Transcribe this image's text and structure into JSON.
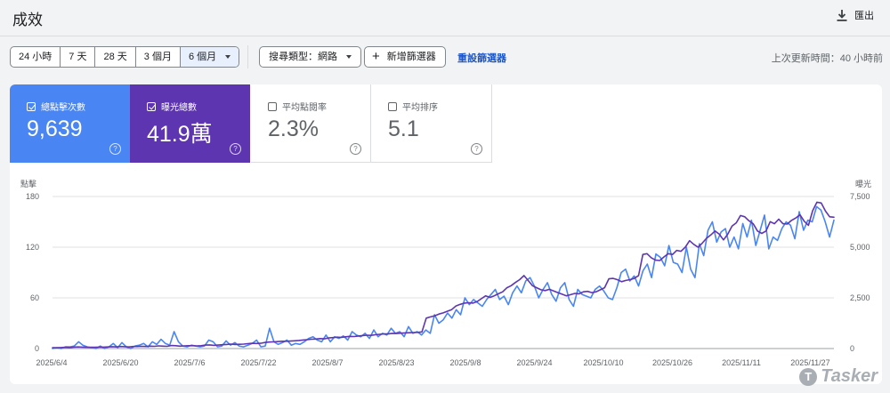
{
  "header": {
    "title": "成效",
    "export_label": "匯出"
  },
  "filters": {
    "date_ranges": [
      {
        "label": "24 小時",
        "selected": false
      },
      {
        "label": "7 天",
        "selected": false
      },
      {
        "label": "28 天",
        "selected": false
      },
      {
        "label": "3 個月",
        "selected": false
      },
      {
        "label": "6 個月",
        "selected": true
      }
    ],
    "search_type": "搜尋類型：網路",
    "add_filter": "新增篩選器",
    "reset": "重設篩選器",
    "last_updated": "上次更新時間：40 小時前"
  },
  "metrics": [
    {
      "label": "總點擊次數",
      "value": "9,639",
      "checked": true,
      "color": "#4a86f3"
    },
    {
      "label": "曝光總數",
      "value": "41.9萬",
      "checked": true,
      "color": "#5e35b1"
    },
    {
      "label": "平均點閱率",
      "value": "2.3%",
      "checked": false
    },
    {
      "label": "平均排序",
      "value": "5.1",
      "checked": false
    }
  ],
  "watermark": "Tasker",
  "chart_data": {
    "type": "line",
    "left_axis_title": "點擊",
    "right_axis_title": "曝光",
    "left_ticks": [
      "180",
      "120",
      "60",
      "0"
    ],
    "right_ticks": [
      "7,500",
      "5,000",
      "2,500",
      "0"
    ],
    "left_range": [
      0,
      180
    ],
    "right_range": [
      0,
      7500
    ],
    "x_tick_labels": [
      "2025/6/4",
      "2025/6/20",
      "2025/7/6",
      "2025/7/22",
      "2025/8/7",
      "2025/8/23",
      "2025/9/8",
      "2025/9/24",
      "2025/10/10",
      "2025/10/26",
      "2025/11/11",
      "2025/11/27"
    ],
    "grid": true,
    "legend": "none",
    "series": [
      {
        "metric": "總點擊次數",
        "axis": "left",
        "color": "#4a86f3",
        "values": [
          0,
          1,
          0,
          2,
          2,
          3,
          8,
          4,
          2,
          1,
          0,
          3,
          0,
          2,
          6,
          1,
          7,
          2,
          0,
          3,
          4,
          6,
          2,
          8,
          5,
          11,
          6,
          4,
          20,
          8,
          3,
          2,
          4,
          3,
          2,
          3,
          10,
          8,
          2,
          3,
          9,
          4,
          7,
          3,
          2,
          4,
          6,
          10,
          2,
          3,
          24,
          8,
          5,
          7,
          10,
          4,
          6,
          5,
          8,
          12,
          14,
          10,
          8,
          16,
          8,
          14,
          12,
          15,
          10,
          20,
          16,
          14,
          18,
          12,
          22,
          14,
          18,
          16,
          24,
          18,
          20,
          14,
          26,
          18,
          20,
          16,
          22,
          18,
          40,
          30,
          34,
          42,
          36,
          46,
          40,
          60,
          52,
          58,
          54,
          50,
          58,
          64,
          70,
          58,
          62,
          52,
          66,
          74,
          66,
          80,
          84,
          74,
          60,
          70,
          78,
          64,
          56,
          72,
          78,
          58,
          50,
          70,
          64,
          62,
          60,
          70,
          74,
          68,
          60,
          58,
          72,
          90,
          94,
          80,
          86,
          74,
          92,
          100,
          84,
          112,
          108,
          98,
          122,
          102,
          100,
          90,
          120,
          94,
          84,
          124,
          110,
          140,
          150,
          126,
          138,
          142,
          120,
          132,
          118,
          148,
          132,
          152,
          122,
          140,
          158,
          118,
          132,
          128,
          142,
          150,
          146,
          130,
          162,
          140,
          152,
          150,
          168,
          164,
          150,
          132,
          152
        ]
      },
      {
        "metric": "曝光總數",
        "axis": "right",
        "color": "#5e35b1",
        "values": [
          40,
          40,
          50,
          60,
          50,
          70,
          80,
          70,
          60,
          60,
          60,
          70,
          70,
          80,
          90,
          80,
          100,
          90,
          80,
          100,
          100,
          110,
          100,
          120,
          110,
          130,
          120,
          110,
          150,
          140,
          120,
          130,
          140,
          140,
          130,
          140,
          170,
          180,
          160,
          170,
          190,
          200,
          220,
          200,
          210,
          220,
          240,
          260,
          250,
          260,
          300,
          320,
          330,
          340,
          360,
          360,
          370,
          380,
          400,
          420,
          440,
          460,
          470,
          490,
          480,
          520,
          540,
          560,
          550,
          580,
          600,
          590,
          620,
          640,
          660,
          650,
          680,
          700,
          720,
          720,
          750,
          740,
          760,
          770,
          780,
          790,
          800,
          820,
          1500,
          1560,
          1620,
          1700,
          1760,
          1840,
          1920,
          2100,
          2180,
          2240,
          2260,
          2240,
          2320,
          2460,
          2600,
          2520,
          2600,
          2700,
          2800,
          3000,
          3100,
          3260,
          3400,
          3600,
          3360,
          3100,
          3000,
          2900,
          2860,
          2920,
          2840,
          2760,
          2680,
          2600,
          2660,
          2720,
          2700,
          2800,
          2820,
          2760,
          2800,
          2900,
          3000,
          3440,
          3460,
          3400,
          3300,
          3360,
          3400,
          3460,
          3600,
          4640,
          4680,
          4480,
          4360,
          4340,
          4520,
          4680,
          4640,
          4840,
          4800,
          5000,
          5320,
          5140,
          5000,
          5200,
          5440,
          5600,
          5800,
          5640,
          5360,
          5640,
          6040,
          6200,
          6560,
          6500,
          6300,
          6160,
          5800,
          5680,
          5800,
          6260,
          6160,
          6380,
          6160,
          6140,
          6320,
          6440,
          6600,
          6280,
          6080,
          6800,
          7220,
          7180,
          6780,
          6500,
          6480
        ]
      }
    ]
  }
}
